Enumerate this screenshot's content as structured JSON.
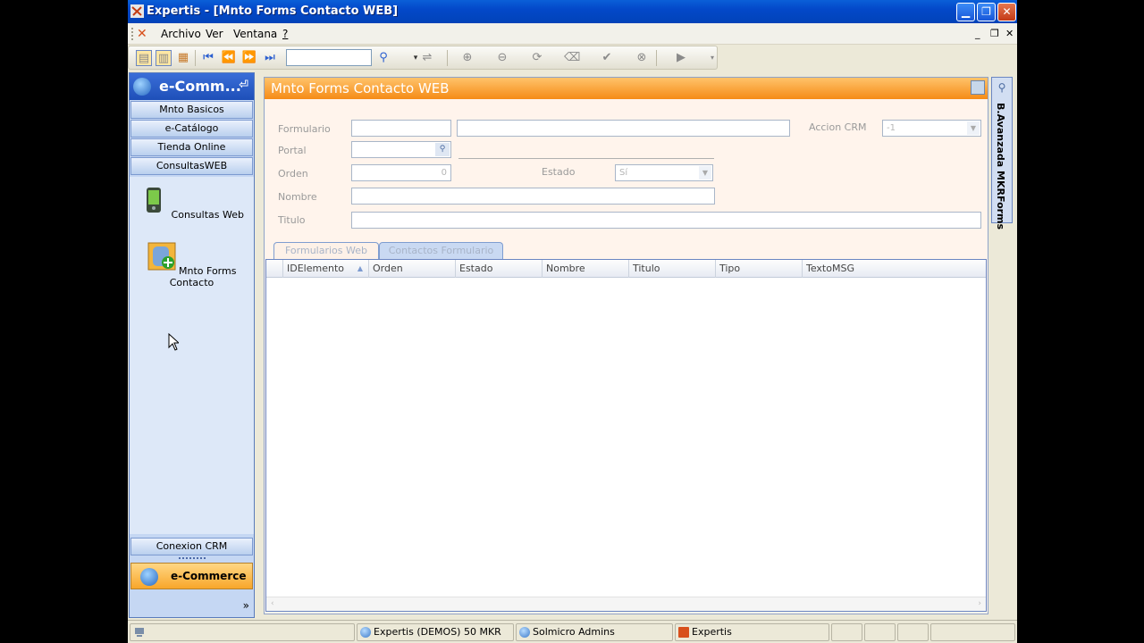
{
  "window": {
    "title": "Expertis - [Mnto Forms Contacto WEB]"
  },
  "menu": {
    "items": [
      "Archivo",
      "Ver",
      "Ventana",
      "?"
    ]
  },
  "nav": {
    "header": "e-Comm...",
    "groups": [
      "Mnto Basicos",
      "e-Catálogo",
      "Tienda Online",
      "ConsultasWEB"
    ],
    "shortcuts": [
      "Consultas Web",
      "Mnto Forms Contacto"
    ],
    "bottom_group": "Conexion CRM",
    "active_module": "e-Commerce",
    "more": "»"
  },
  "form": {
    "title": "Mnto Forms Contacto WEB",
    "labels": {
      "formulario": "Formulario",
      "portal": "Portal",
      "orden": "Orden",
      "nombre": "Nombre",
      "titulo": "Titulo",
      "estado": "Estado",
      "accion_crm": "Accion CRM"
    },
    "values": {
      "orden": "0",
      "estado": "Sí",
      "accion_crm": "-1"
    },
    "tabs": [
      "Formularios Web",
      "Contactos Formulario"
    ],
    "grid_columns": [
      "IDElemento",
      "Orden",
      "Estado",
      "Nombre",
      "Titulo",
      "Tipo",
      "TextoMSG"
    ]
  },
  "side_panel": {
    "label": "B.Avanzada MKRForms"
  },
  "statusbar": {
    "cells": [
      "Expertis (DEMOS) 50 MKR",
      "Solmicro Admins",
      "Expertis"
    ]
  },
  "colors": {
    "titlebar": "#0348c9",
    "form_header": "#f58b16",
    "active_module": "#f8a62a",
    "nav_bg": "#c5d7f3"
  }
}
